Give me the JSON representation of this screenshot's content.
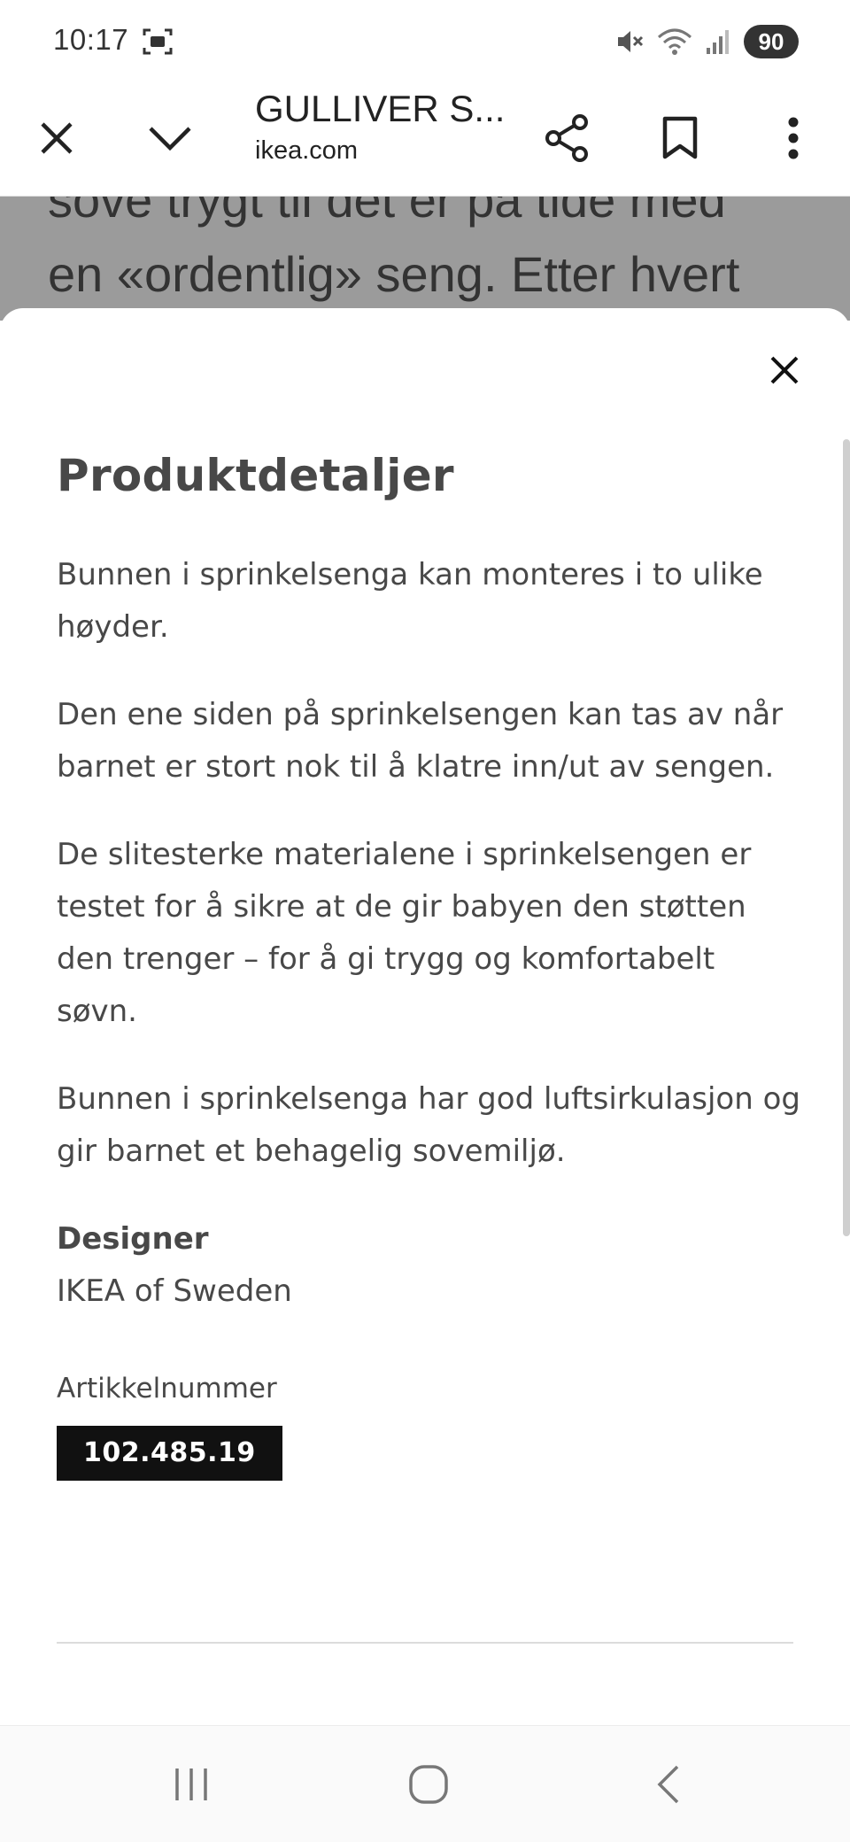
{
  "status_bar": {
    "time": "10:17",
    "battery": "90",
    "icons": [
      "screenshot-icon",
      "mute-icon",
      "wifi-icon",
      "signal-icon"
    ]
  },
  "browser": {
    "title": "GULLIVER S...",
    "url": "ikea.com",
    "icons": [
      "close-icon",
      "chevron-down-icon",
      "share-icon",
      "bookmark-icon",
      "more-icon"
    ]
  },
  "background_page": {
    "line1": "sove trygt til det er på tide med",
    "line2": "en «ordentlig» seng. Etter hvert"
  },
  "sheet": {
    "title": "Produktdetaljer",
    "paragraphs": [
      "Bunnen i sprinkelsenga kan monteres i to ulike høyder.",
      "Den ene siden på sprinkelsengen kan tas av når barnet er stort nok til å klatre inn/ut av sengen.",
      "De slitesterke materialene i sprinkelsengen er testet for å sikre at de gir babyen den støtten den trenger – for å gi trygg og komfortabelt søvn.",
      "Bunnen i sprinkelsenga har god luftsirkulasjon og gir barnet et behagelig sovemiljø."
    ],
    "designer_label": "Designer",
    "designer_value": "IKEA of Sweden",
    "article_label": "Artikkelnummer",
    "article_number": "102.485.19"
  },
  "nav_bar": {
    "icons": [
      "recent-apps-icon",
      "home-icon",
      "back-icon"
    ]
  },
  "colors": {
    "text": "#484848",
    "dim_overlay": "#9b9b9b",
    "article_badge_bg": "#111111"
  }
}
